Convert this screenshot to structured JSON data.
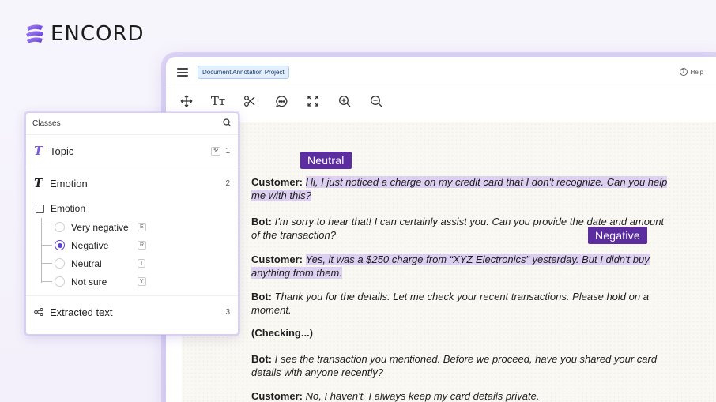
{
  "brand": {
    "name": "ENCORD",
    "accent": "#7b5be6"
  },
  "app": {
    "project_name": "Document Annotation Project",
    "help_label": "Help"
  },
  "toolbar": {
    "tools": [
      "move-icon",
      "text-size-icon",
      "scissors-icon",
      "comment-icon",
      "expand-icon",
      "zoom-in-icon",
      "zoom-out-icon"
    ],
    "text_tool_glyph": "Tт"
  },
  "classes_panel": {
    "title": "Classes",
    "topic": {
      "label": "Topic",
      "count": "1"
    },
    "emotion": {
      "label": "Emotion",
      "count": "2",
      "sub_label": "Emotion",
      "options": [
        {
          "label": "Very negative",
          "key": "E",
          "selected": false
        },
        {
          "label": "Negative",
          "key": "R",
          "selected": true
        },
        {
          "label": "Neutral",
          "key": "T",
          "selected": false
        },
        {
          "label": "Not sure",
          "key": "Y",
          "selected": false
        }
      ]
    },
    "extracted": {
      "label": "Extracted text",
      "count": "3"
    }
  },
  "document": {
    "tags": {
      "neutral": "Neutral",
      "negative": "Negative"
    },
    "highlight_color": "#baa0f0",
    "tag_color": "#5b2d9e",
    "p1": {
      "speaker": "Customer:",
      "line1": "Hi, I just noticed a charge on my credit card that I don't recognize. Can you help",
      "line2": "me with this?"
    },
    "p2": {
      "speaker": "Bot:",
      "line1": "I'm sorry to hear that! I can certainly assist you. Can you provide the date and amount",
      "line2": "of the transaction?"
    },
    "p3": {
      "speaker": "Customer:",
      "line1": "Yes, it was a $250 charge from “XYZ Electronics” yesterday. But I didn't buy",
      "line2": "anything from them."
    },
    "p4": {
      "speaker": "Bot:",
      "line1": "Thank you for the details. Let me check your recent transactions. Please hold on a",
      "line2": "moment."
    },
    "p5": {
      "text": "(Checking...)"
    },
    "p6": {
      "speaker": "Bot:",
      "line1": "I see the transaction you mentioned. Before we proceed, have you shared your card",
      "line2": "details with anyone recently?"
    },
    "p7": {
      "speaker": "Customer:",
      "line1": "No, I haven't. I always keep my card details private."
    }
  }
}
